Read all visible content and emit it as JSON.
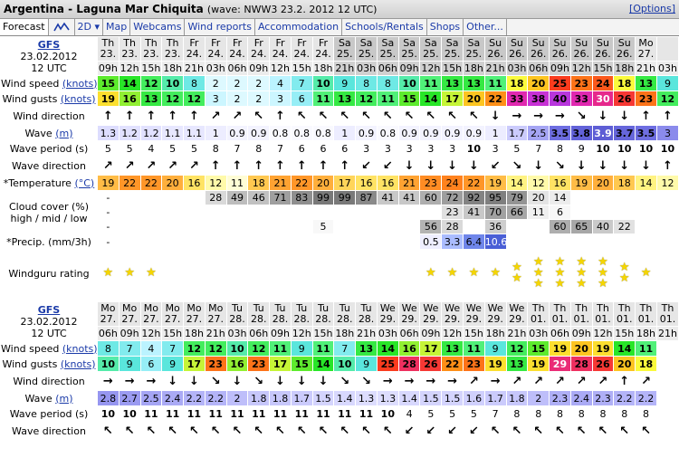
{
  "header": {
    "title": "Argentina - Laguna Mar Chiquita",
    "subtitle": "(wave: NWW3 23.2. 2012 12 UTC)",
    "options": "[Options]"
  },
  "tabs": [
    {
      "label": "Forecast"
    },
    {
      "label": "2D ▾"
    },
    {
      "label": "Map"
    },
    {
      "label": "Webcams"
    },
    {
      "label": "Wind reports"
    },
    {
      "label": "Accommodation"
    },
    {
      "label": "Schools/Rentals"
    },
    {
      "label": "Shops"
    },
    {
      "label": "Other..."
    }
  ],
  "colors": {
    "link": "#1a3aa8"
  },
  "blocks": [
    {
      "model": "GFS",
      "date": "23.02.2012",
      "utc": "12 UTC",
      "days": [
        "Th 23.",
        "Th 23.",
        "Th 23.",
        "Th 23.",
        "Fr 24.",
        "Fr 24.",
        "Fr 24.",
        "Fr 24.",
        "Fr 24.",
        "Fr 24.",
        "Fr 24.",
        "Sa 25.",
        "Sa 25.",
        "Sa 25.",
        "Sa 25.",
        "Sa 25.",
        "Sa 25.",
        "Sa 25.",
        "Su 26.",
        "Su 26.",
        "Su 26.",
        "Su 26.",
        "Su 26.",
        "Su 26.",
        "Su 26.",
        "Mo 27."
      ],
      "hours": [
        "09h",
        "12h",
        "15h",
        "18h",
        "21h",
        "03h",
        "06h",
        "09h",
        "12h",
        "15h",
        "18h",
        "21h",
        "03h",
        "06h",
        "09h",
        "12h",
        "15h",
        "18h",
        "21h",
        "03h",
        "06h",
        "09h",
        "12h",
        "15h",
        "18h",
        "21h",
        "03h"
      ],
      "labels": {
        "speed": "Wind speed",
        "gusts": "Wind gusts",
        "units": "(knots)",
        "winddir": "Wind direction",
        "wave": "Wave",
        "wave_unit": "(m)",
        "period": "Wave period (s)",
        "wavedir": "Wave direction",
        "temp": "*Temperature",
        "temp_unit": "(°C)",
        "cloud1": "Cloud cover (%)",
        "cloud2": "high / mid / low",
        "precip": "*Precip. (mm/3h)",
        "rating": "Windguru rating"
      },
      "speed": [
        "15",
        "14",
        "12",
        "10",
        "8",
        "2",
        "2",
        "2",
        "4",
        "7",
        "10",
        "9",
        "8",
        "8",
        "10",
        "11",
        "13",
        "13",
        "11",
        "18",
        "20",
        "25",
        "23",
        "24",
        "18",
        "13",
        "9"
      ],
      "gusts": [
        "19",
        "16",
        "13",
        "12",
        "12",
        "3",
        "2",
        "2",
        "3",
        "6",
        "11",
        "13",
        "12",
        "11",
        "15",
        "14",
        "17",
        "20",
        "22",
        "33",
        "38",
        "40",
        "33",
        "30",
        "26",
        "23",
        "12"
      ],
      "winddir": [
        "↑",
        "↑",
        "↑",
        "↑",
        "↑",
        "↗",
        "↗",
        "↖",
        "↑",
        "↖",
        "↖",
        "↖",
        "↖",
        "↖",
        "↖",
        "↖",
        "↖",
        "↖",
        "↓",
        "→",
        "→",
        "→",
        "↘",
        "↓",
        "↓",
        "↑",
        "↑"
      ],
      "wave": [
        "1.3",
        "1.2",
        "1.2",
        "1.1",
        "1.1",
        "1",
        "0.9",
        "0.9",
        "0.8",
        "0.8",
        "0.8",
        "1",
        "0.9",
        "0.8",
        "0.9",
        "0.9",
        "0.9",
        "0.9",
        "1",
        "1.7",
        "2.5",
        "3.5",
        "3.8",
        "3.9",
        "3.7",
        "3.5",
        "3"
      ],
      "period": [
        "5",
        "5",
        "4",
        "5",
        "5",
        "8",
        "7",
        "8",
        "7",
        "6",
        "6",
        "6",
        "3",
        "3",
        "3",
        "3",
        "3",
        "10",
        "3",
        "5",
        "7",
        "8",
        "9",
        "10",
        "10",
        "10",
        "10"
      ],
      "wavedir": [
        "↗",
        "↗",
        "↗",
        "↗",
        "↗",
        "↑",
        "↑",
        "↑",
        "↑",
        "↑",
        "↑",
        "↑",
        "↙",
        "↙",
        "↓",
        "↓",
        "↓",
        "↓",
        "↙",
        "↘",
        "↓",
        "↘",
        "↓",
        "↓",
        "↓",
        "↓",
        "↑"
      ],
      "temp": [
        "19",
        "22",
        "22",
        "20",
        "16",
        "12",
        "11",
        "18",
        "21",
        "22",
        "20",
        "17",
        "16",
        "16",
        "21",
        "23",
        "24",
        "22",
        "19",
        "14",
        "12",
        "16",
        "19",
        "20",
        "18",
        "14",
        "12"
      ],
      "cloud_high": [
        "-",
        "",
        "",
        "",
        "",
        "28",
        "49",
        "46",
        "71",
        "83",
        "99",
        "99",
        "87",
        "41",
        "41",
        "60",
        "72",
        "92",
        "95",
        "79",
        "20",
        "14",
        "",
        "",
        "",
        "",
        ""
      ],
      "cloud_mid": [
        "-",
        "",
        "",
        "",
        "",
        "",
        "",
        "",
        "",
        "",
        "",
        "",
        "",
        "",
        "",
        "",
        "23",
        "41",
        "70",
        "66",
        "11",
        "6",
        "",
        "",
        "",
        "",
        ""
      ],
      "cloud_low": [
        "-",
        "",
        "",
        "",
        "",
        "",
        "",
        "",
        "",
        "",
        "5",
        "",
        "",
        "",
        "",
        "56",
        "28",
        "",
        "36",
        "",
        "",
        "60",
        "65",
        "40",
        "22",
        "",
        ""
      ],
      "precip": [
        "-",
        "",
        "",
        "",
        "",
        "",
        "",
        "",
        "",
        "",
        "",
        "",
        "",
        "",
        "",
        "0.5",
        "3.3",
        "6.4",
        "10.6",
        "",
        "",
        "",
        "",
        "",
        "",
        "",
        ""
      ],
      "rating": [
        1,
        1,
        1,
        0,
        0,
        0,
        0,
        0,
        0,
        0,
        0,
        0,
        0,
        0,
        0,
        1,
        1,
        1,
        1,
        2,
        3,
        3,
        3,
        3,
        2,
        1,
        0
      ]
    },
    {
      "model": "GFS",
      "date": "23.02.2012",
      "utc": "12 UTC",
      "days": [
        "Mo 27.",
        "Mo 27.",
        "Mo 27.",
        "Mo 27.",
        "Mo 27.",
        "Mo 27.",
        "Tu 28.",
        "Tu 28.",
        "Tu 28.",
        "Tu 28.",
        "Tu 28.",
        "Tu 28.",
        "Tu 28.",
        "We 29.",
        "We 29.",
        "We 29.",
        "We 29.",
        "We 29.",
        "We 29.",
        "We 29.",
        "Th 01.",
        "Th 01.",
        "Th 01.",
        "Th 01.",
        "Th 01.",
        "Th 01.",
        "Th 01."
      ],
      "hours": [
        "06h",
        "09h",
        "12h",
        "15h",
        "18h",
        "21h",
        "03h",
        "06h",
        "09h",
        "12h",
        "15h",
        "18h",
        "21h",
        "03h",
        "06h",
        "09h",
        "12h",
        "15h",
        "18h",
        "21h",
        "03h",
        "06h",
        "09h",
        "12h",
        "15h",
        "18h",
        "21h"
      ],
      "labels": {
        "speed": "Wind speed",
        "gusts": "Wind gusts",
        "units": "(knots)",
        "winddir": "Wind direction",
        "wave": "Wave",
        "wave_unit": "(m)",
        "period": "Wave period (s)",
        "wavedir": "Wave direction"
      },
      "speed": [
        "8",
        "7",
        "4",
        "7",
        "12",
        "12",
        "10",
        "12",
        "11",
        "9",
        "11",
        "7",
        "13",
        "14",
        "16",
        "17",
        "13",
        "11",
        "9",
        "12",
        "15",
        "19",
        "20",
        "19",
        "14",
        "11",
        ""
      ],
      "gusts": [
        "10",
        "9",
        "6",
        "9",
        "17",
        "23",
        "16",
        "23",
        "17",
        "15",
        "14",
        "10",
        "9",
        "25",
        "28",
        "26",
        "22",
        "23",
        "19",
        "13",
        "19",
        "29",
        "28",
        "26",
        "20",
        "18",
        ""
      ],
      "winddir": [
        "→",
        "→",
        "→",
        "↓",
        "↓",
        "↘",
        "↓",
        "↘",
        "↓",
        "↓",
        "↓",
        "↘",
        "↘",
        "→",
        "→",
        "→",
        "→",
        "↗",
        "→",
        "↗",
        "↗",
        "↗",
        "↗",
        "↗",
        "↑",
        "↗",
        ""
      ],
      "wave": [
        "2.8",
        "2.7",
        "2.5",
        "2.4",
        "2.2",
        "2.2",
        "2",
        "1.8",
        "1.8",
        "1.7",
        "1.5",
        "1.4",
        "1.3",
        "1.3",
        "1.4",
        "1.5",
        "1.5",
        "1.6",
        "1.7",
        "1.8",
        "2",
        "2.3",
        "2.4",
        "2.3",
        "2.2",
        "2.2",
        ""
      ],
      "period": [
        "10",
        "10",
        "11",
        "11",
        "11",
        "11",
        "11",
        "11",
        "11",
        "11",
        "11",
        "11",
        "11",
        "10",
        "4",
        "5",
        "5",
        "5",
        "7",
        "8",
        "8",
        "8",
        "8",
        "8",
        "8",
        "8",
        ""
      ],
      "wavedir": [
        "↖",
        "↖",
        "↖",
        "↖",
        "↖",
        "↖",
        "↖",
        "↖",
        "↖",
        "↖",
        "↖",
        "↖",
        "↖",
        "↖",
        "↙",
        "↙",
        "↙",
        "↙",
        "↖",
        "↖",
        "↖",
        "↖",
        "↖",
        "↖",
        "↖",
        "↖",
        ""
      ]
    }
  ]
}
